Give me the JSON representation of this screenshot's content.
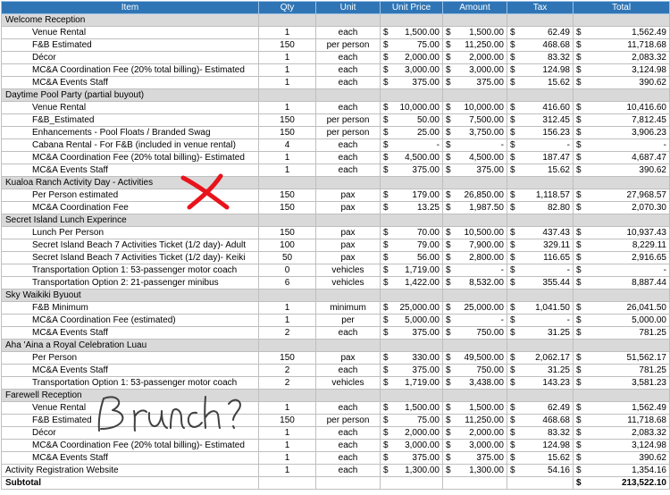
{
  "headers": {
    "item": "Item",
    "qty": "Qty",
    "unit": "Unit",
    "unit_price": "Unit Price",
    "amount": "Amount",
    "tax": "Tax",
    "total": "Total"
  },
  "currency_symbol": "$",
  "rows": [
    {
      "type": "section",
      "item": "Welcome Reception"
    },
    {
      "type": "line",
      "item": "Venue Rental",
      "qty": "1",
      "unit": "each",
      "unit_price": "1,500.00",
      "amount": "1,500.00",
      "tax": "62.49",
      "total": "1,562.49"
    },
    {
      "type": "line",
      "item": "F&B Estimated",
      "qty": "150",
      "unit": "per person",
      "unit_price": "75.00",
      "amount": "11,250.00",
      "tax": "468.68",
      "total": "11,718.68"
    },
    {
      "type": "line",
      "item": "Décor",
      "qty": "1",
      "unit": "each",
      "unit_price": "2,000.00",
      "amount": "2,000.00",
      "tax": "83.32",
      "total": "2,083.32"
    },
    {
      "type": "line",
      "item": "MC&A Coordination Fee (20% total billing)- Estimated",
      "qty": "1",
      "unit": "each",
      "unit_price": "3,000.00",
      "amount": "3,000.00",
      "tax": "124.98",
      "total": "3,124.98"
    },
    {
      "type": "line",
      "item": "MC&A Events Staff",
      "qty": "1",
      "unit": "each",
      "unit_price": "375.00",
      "amount": "375.00",
      "tax": "15.62",
      "total": "390.62"
    },
    {
      "type": "section",
      "item": "Daytime Pool Party (partial buyout)"
    },
    {
      "type": "line",
      "item": "Venue Rental",
      "qty": "1",
      "unit": "each",
      "unit_price": "10,000.00",
      "amount": "10,000.00",
      "tax": "416.60",
      "total": "10,416.60"
    },
    {
      "type": "line",
      "item": "F&B_Estimated",
      "qty": "150",
      "unit": "per person",
      "unit_price": "50.00",
      "amount": "7,500.00",
      "tax": "312.45",
      "total": "7,812.45"
    },
    {
      "type": "line",
      "item": "Enhancements - Pool Floats / Branded Swag",
      "qty": "150",
      "unit": "per person",
      "unit_price": "25.00",
      "amount": "3,750.00",
      "tax": "156.23",
      "total": "3,906.23"
    },
    {
      "type": "line",
      "item": "Cabana Rental - For F&B (included in venue rental)",
      "qty": "4",
      "unit": "each",
      "unit_price": "-",
      "amount": "-",
      "tax": "-",
      "total": "-"
    },
    {
      "type": "line",
      "item": "MC&A Coordination Fee (20% total billing)- Estimated",
      "qty": "1",
      "unit": "each",
      "unit_price": "4,500.00",
      "amount": "4,500.00",
      "tax": "187.47",
      "total": "4,687.47"
    },
    {
      "type": "line",
      "item": "MC&A Events Staff",
      "qty": "1",
      "unit": "each",
      "unit_price": "375.00",
      "amount": "375.00",
      "tax": "15.62",
      "total": "390.62"
    },
    {
      "type": "section",
      "item": "Kualoa Ranch Activity Day - Activities"
    },
    {
      "type": "line",
      "item": "Per Person estimated",
      "qty": "150",
      "unit": "pax",
      "unit_price": "179.00",
      "amount": "26,850.00",
      "tax": "1,118.57",
      "total": "27,968.57"
    },
    {
      "type": "line",
      "item": "MC&A Coordination Fee",
      "qty": "150",
      "unit": "pax",
      "unit_price": "13.25",
      "amount": "1,987.50",
      "tax": "82.80",
      "total": "2,070.30"
    },
    {
      "type": "section",
      "item": "Secret Island Lunch Experince"
    },
    {
      "type": "line",
      "item": "Lunch Per Person",
      "qty": "150",
      "unit": "pax",
      "unit_price": "70.00",
      "amount": "10,500.00",
      "tax": "437.43",
      "total": "10,937.43"
    },
    {
      "type": "line",
      "item": "Secret Island Beach 7 Activities Ticket (1/2 day)- Adult",
      "qty": "100",
      "unit": "pax",
      "unit_price": "79.00",
      "amount": "7,900.00",
      "tax": "329.11",
      "total": "8,229.11"
    },
    {
      "type": "line",
      "item": "Secret Island Beach 7 Activities Ticket (1/2 day)- Keiki",
      "qty": "50",
      "unit": "pax",
      "unit_price": "56.00",
      "amount": "2,800.00",
      "tax": "116.65",
      "total": "2,916.65"
    },
    {
      "type": "line",
      "item": "Transportation Option 1: 53-passenger motor coach",
      "qty": "0",
      "unit": "vehicles",
      "unit_price": "1,719.00",
      "amount": "-",
      "tax": "-",
      "total": "-"
    },
    {
      "type": "line",
      "item": "Transportation Option 2: 21-passenger minibus",
      "qty": "6",
      "unit": "vehicles",
      "unit_price": "1,422.00",
      "amount": "8,532.00",
      "tax": "355.44",
      "total": "8,887.44"
    },
    {
      "type": "section",
      "item": "Sky Waikiki Byuout"
    },
    {
      "type": "line",
      "item": "F&B Minimum",
      "qty": "1",
      "unit": "minimum",
      "unit_price": "25,000.00",
      "amount": "25,000.00",
      "tax": "1,041.50",
      "total": "26,041.50"
    },
    {
      "type": "line",
      "item": "MC&A Coordination Fee (estimated)",
      "qty": "1",
      "unit": "per",
      "unit_price": "5,000.00",
      "amount": "-",
      "tax": "-",
      "total": "5,000.00"
    },
    {
      "type": "line",
      "item": "MC&A Events Staff",
      "qty": "2",
      "unit": "each",
      "unit_price": "375.00",
      "amount": "750.00",
      "tax": "31.25",
      "total": "781.25"
    },
    {
      "type": "section",
      "item": "Aha 'Aina a Royal Celebration Luau"
    },
    {
      "type": "line",
      "item": "Per Person",
      "qty": "150",
      "unit": "pax",
      "unit_price": "330.00",
      "amount": "49,500.00",
      "tax": "2,062.17",
      "total": "51,562.17"
    },
    {
      "type": "line",
      "item": "MC&A Events Staff",
      "qty": "2",
      "unit": "each",
      "unit_price": "375.00",
      "amount": "750.00",
      "tax": "31.25",
      "total": "781.25"
    },
    {
      "type": "line",
      "item": "Transportation Option 1: 53-passenger motor coach",
      "qty": "2",
      "unit": "vehicles",
      "unit_price": "1,719.00",
      "amount": "3,438.00",
      "tax": "143.23",
      "total": "3,581.23"
    },
    {
      "type": "section",
      "item": "Farewell Reception"
    },
    {
      "type": "line",
      "item": "Venue Rental",
      "qty": "1",
      "unit": "each",
      "unit_price": "1,500.00",
      "amount": "1,500.00",
      "tax": "62.49",
      "total": "1,562.49"
    },
    {
      "type": "line",
      "item": "F&B Estimated",
      "qty": "150",
      "unit": "per person",
      "unit_price": "75.00",
      "amount": "11,250.00",
      "tax": "468.68",
      "total": "11,718.68"
    },
    {
      "type": "line",
      "item": "Décor",
      "qty": "1",
      "unit": "each",
      "unit_price": "2,000.00",
      "amount": "2,000.00",
      "tax": "83.32",
      "total": "2,083.32"
    },
    {
      "type": "line",
      "item": "MC&A Coordination Fee (20% total billing)- Estimated",
      "qty": "1",
      "unit": "each",
      "unit_price": "3,000.00",
      "amount": "3,000.00",
      "tax": "124.98",
      "total": "3,124.98"
    },
    {
      "type": "line",
      "item": "MC&A Events Staff",
      "qty": "1",
      "unit": "each",
      "unit_price": "375.00",
      "amount": "375.00",
      "tax": "15.62",
      "total": "390.62"
    },
    {
      "type": "top",
      "item": "Activity Registration Website",
      "qty": "1",
      "unit": "each",
      "unit_price": "1,300.00",
      "amount": "1,300.00",
      "tax": "54.16",
      "total": "1,354.16"
    }
  ],
  "subtotal": {
    "label": "Subtotal",
    "total": "213,522.10"
  },
  "annotations": {
    "red_x_mark": "red-x-mark",
    "handwriting": "Brunch?",
    "red_color": "#e8141c",
    "ink_color": "#404040"
  },
  "colors": {
    "header_bg": "#2f75b5",
    "header_text": "#ffffff",
    "section_bg": "#d9d9d9"
  }
}
